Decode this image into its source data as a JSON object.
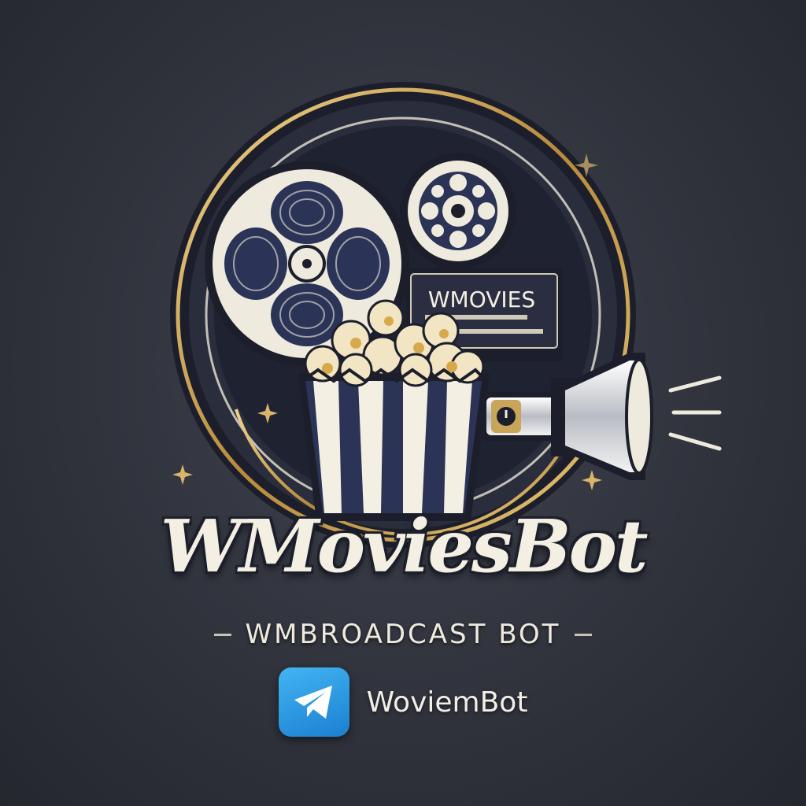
{
  "logo": {
    "screen_text": "WMOVIES",
    "brand_name": "WMoviesBot",
    "tagline": "WMBROADCAST BOT",
    "handle": "WoviemBot"
  },
  "icons": [
    "film-reel-icon",
    "movie-camera-icon",
    "popcorn-icon",
    "projector-light-icon",
    "sparkle-icon",
    "telegram-icon"
  ],
  "colors": {
    "background": "#30333c",
    "gold": "#c9a55a",
    "cream": "#f3efe2",
    "navy": "#1c1f2b",
    "telegram_blue": "#2a9ae6"
  }
}
